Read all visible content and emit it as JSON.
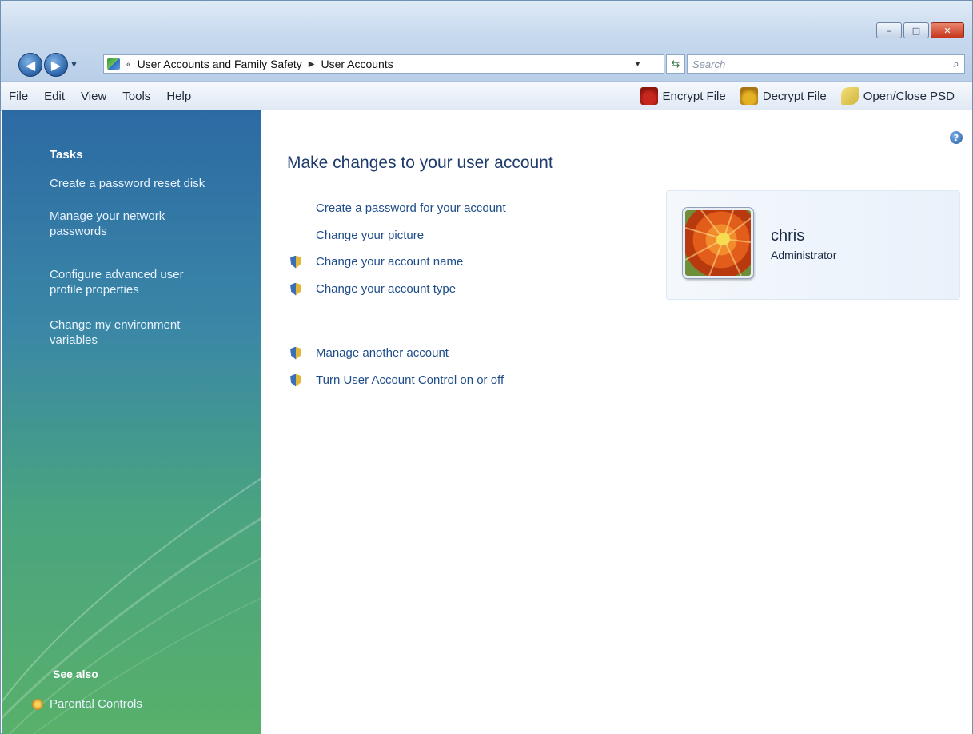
{
  "window": {
    "caption_buttons": [
      "minimize",
      "maximize",
      "close"
    ]
  },
  "nav": {
    "back_icon": "back-arrow-icon",
    "forward_icon": "forward-arrow-icon"
  },
  "address_bar": {
    "overflow": "«",
    "segments": [
      "User Accounts and Family Safety",
      "User Accounts"
    ]
  },
  "search": {
    "placeholder": "Search"
  },
  "menu": {
    "items": [
      "File",
      "Edit",
      "View",
      "Tools",
      "Help"
    ]
  },
  "toolbar": {
    "encrypt_label": "Encrypt File",
    "decrypt_label": "Decrypt File",
    "psd_label": "Open/Close PSD"
  },
  "leftpane": {
    "tasks_heading": "Tasks",
    "tasks": [
      "Create a password reset disk",
      "Manage your network passwords",
      "Configure advanced user profile properties",
      "Change my environment variables"
    ],
    "see_also_heading": "See also",
    "see_also": [
      "Parental Controls"
    ]
  },
  "main": {
    "title": "Make changes to your user account",
    "tasks": [
      {
        "label": "Create a password for your account",
        "shield": false
      },
      {
        "label": "Change your picture",
        "shield": false
      },
      {
        "label": "Change your account name",
        "shield": true
      },
      {
        "label": "Change your account type",
        "shield": true
      },
      {
        "label": "Manage another account",
        "shield": true
      },
      {
        "label": "Turn User Account Control on or off",
        "shield": true
      }
    ]
  },
  "user": {
    "name": "chris",
    "role": "Administrator"
  }
}
